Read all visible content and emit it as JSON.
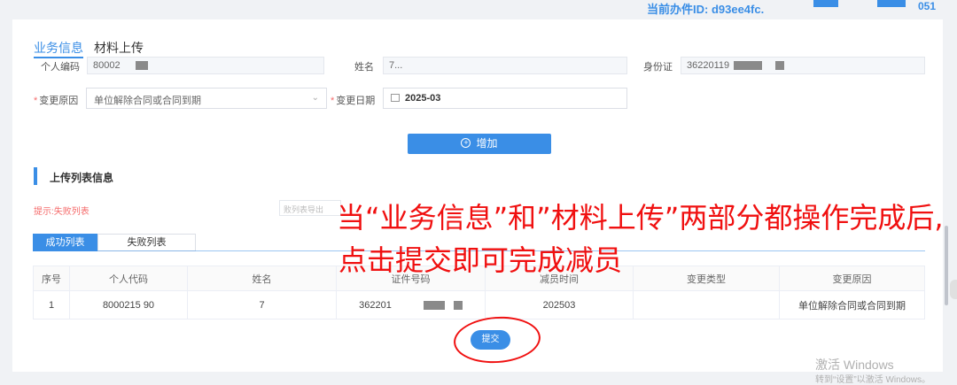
{
  "topbar": {
    "case_id": "当前办件ID: d93ee4fc.",
    "num": "051"
  },
  "tabs": {
    "business": "业务信息",
    "materials": "材料上传"
  },
  "form": {
    "personal_code_label": "个人编码",
    "personal_code_value": "80002",
    "name_label": "姓名",
    "name_value": "7...",
    "id_label": "身份证",
    "id_value": "36220119",
    "reason_label": "变更原因",
    "reason_value": "单位解除合同或合同到期",
    "date_label": "变更日期",
    "date_value": "2025-03"
  },
  "add_button": "增加",
  "upload_section": {
    "title": "上传列表信息",
    "hint": "提示:失败列表",
    "hint_box": "败列表导出"
  },
  "subtabs": {
    "success": "成功列表",
    "failed": "失败列表"
  },
  "table": {
    "headers": [
      "序号",
      "个人代码",
      "姓名",
      "证件号码",
      "减员时间",
      "变更类型",
      "变更原因"
    ],
    "rows": [
      {
        "seq": "1",
        "code": "8000215      90",
        "name": "7",
        "id": "362201",
        "time": "202503",
        "type": "",
        "reason": "单位解除合同或合同到期"
      }
    ]
  },
  "submit_button": "提交",
  "annotation": {
    "line1": "当“业务信息”和”材料上传”两部分都操作完成后,",
    "line2": "点击提交即可完成减员"
  },
  "watermark": {
    "line1": "激活 Windows",
    "line2": "转到“设置”以激活 Windows。"
  },
  "colors": {
    "accent": "#3a8ee6",
    "annotation": "#f01010",
    "required": "#f56c6c"
  }
}
